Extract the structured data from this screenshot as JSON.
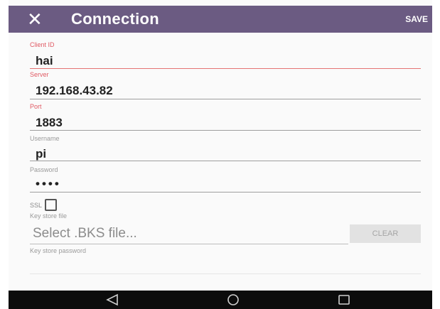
{
  "appbar": {
    "close_icon": "close-icon",
    "title": "Connection",
    "save_label": "SAVE"
  },
  "fields": {
    "client_id": {
      "label": "Client ID",
      "value": "hai"
    },
    "server": {
      "label": "Server",
      "value": "192.168.43.82"
    },
    "port": {
      "label": "Port",
      "value": "1883"
    },
    "username": {
      "label": "Username",
      "value": "pi"
    },
    "password": {
      "label": "Password",
      "value": "••••"
    }
  },
  "ssl": {
    "label": "SSL",
    "checked": false
  },
  "key_store": {
    "file_label": "Key store file",
    "select_text": "Select .BKS file...",
    "clear_label": "CLEAR",
    "password_label": "Key store password",
    "password_value": ""
  },
  "navbar": {
    "icons": [
      "back-icon",
      "home-icon",
      "recents-icon"
    ]
  },
  "colors": {
    "appbar": "#6b5b82",
    "accent": "#e57373",
    "navbar": "#0c0c0c"
  }
}
